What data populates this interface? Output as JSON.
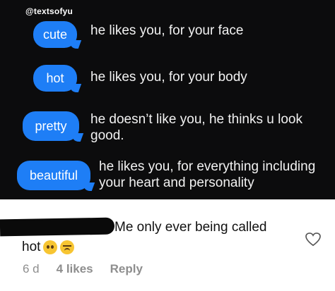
{
  "watermark": "@textsofyu",
  "rows": [
    {
      "bubble": "cute",
      "text": "he likes you, for your face"
    },
    {
      "bubble": "hot",
      "text": "he likes you, for your body"
    },
    {
      "bubble": "pretty",
      "text": "he doesn’t like you, he thinks u look good."
    },
    {
      "bubble": "beautiful",
      "text": "he likes you, for everything including your heart and personality"
    }
  ],
  "comment": {
    "line1": "Me only ever being called",
    "line2": "hot",
    "emojis": [
      "crying-face",
      "confounded-face"
    ],
    "time": "6 d",
    "likes": "4 likes",
    "reply": "Reply"
  },
  "colors": {
    "bubble": "#1e7ef6",
    "dark_bg": "#0c0c0d"
  }
}
